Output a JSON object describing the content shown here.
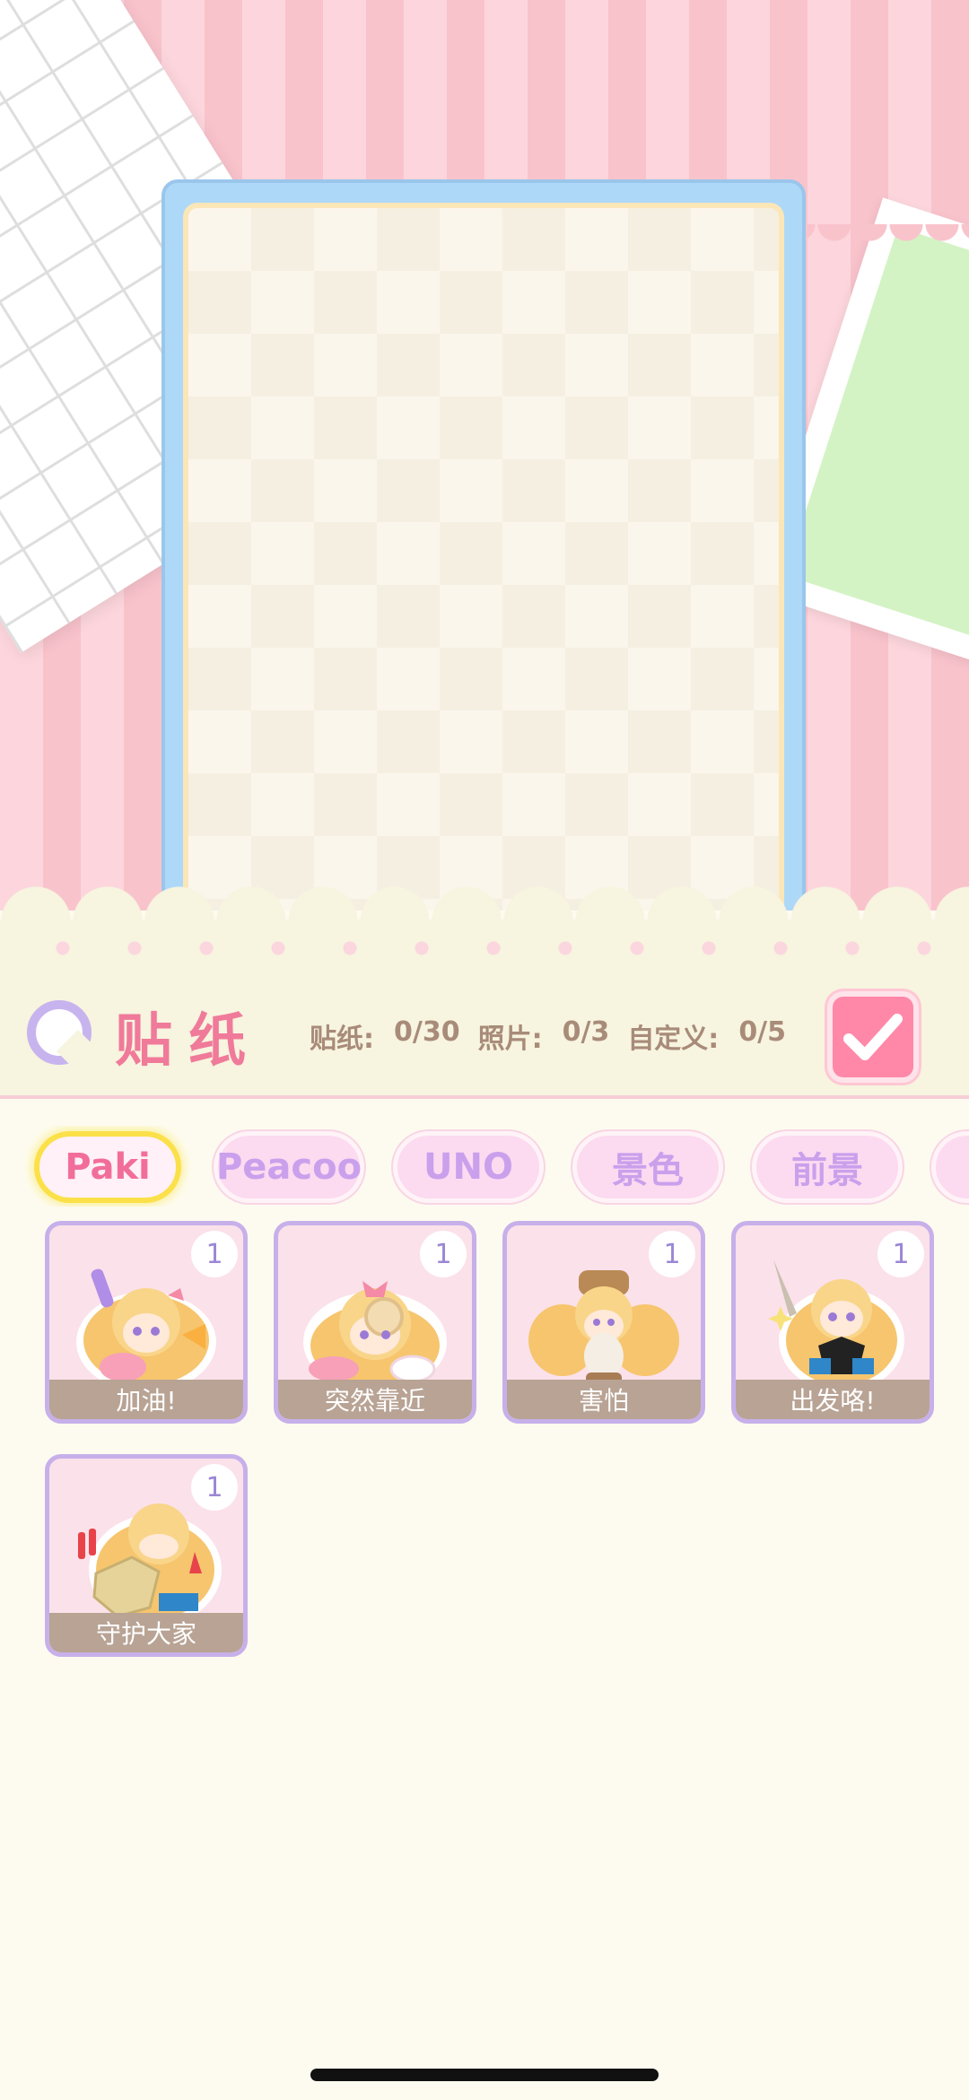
{
  "panel": {
    "title": "贴纸",
    "counts": [
      {
        "label": "贴纸:",
        "value": "0/30"
      },
      {
        "label": "照片:",
        "value": "0/3"
      },
      {
        "label": "自定义:",
        "value": "0/5"
      }
    ]
  },
  "tabs": [
    {
      "label": "Paki",
      "active": true
    },
    {
      "label": "Peacoo",
      "active": false
    },
    {
      "label": "UNO",
      "active": false
    },
    {
      "label": "景色",
      "active": false
    },
    {
      "label": "前景",
      "active": false
    }
  ],
  "stickers": [
    {
      "caption": "加油!",
      "qty": "1",
      "icon": "cheer-sticker-icon"
    },
    {
      "caption": "突然靠近",
      "qty": "1",
      "icon": "lean-in-sticker-icon"
    },
    {
      "caption": "害怕",
      "qty": "1",
      "icon": "scared-sticker-icon"
    },
    {
      "caption": "出发咯!",
      "qty": "1",
      "icon": "set-off-sticker-icon"
    },
    {
      "caption": "守护大家",
      "qty": "1",
      "icon": "guard-sticker-icon"
    }
  ],
  "colors": {
    "accent_pink": "#f07a9a",
    "tab_inactive_text": "#caa0ec",
    "tab_active_border": "#fbe04a",
    "frame_blue": "#aed8f8",
    "confirm_bg": "#ff88a8"
  },
  "icons": {
    "panel_icon": "sticker-icon",
    "confirm": "checkmark-icon"
  }
}
